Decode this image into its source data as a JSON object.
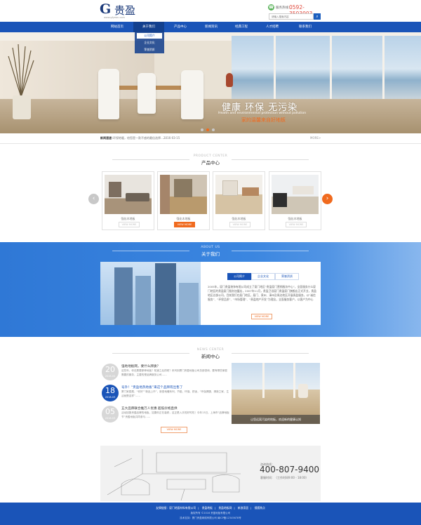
{
  "header": {
    "logo": {
      "latin": "G",
      "cn": "贵盈",
      "url": "www.gfyeon.com"
    },
    "hotline": {
      "label": "服务热线：",
      "number": "0592-3503003"
    },
    "search": {
      "placeholder": "请输入搜索内容",
      "icon": "search-icon"
    }
  },
  "nav": {
    "items": [
      {
        "label": "网站首页"
      },
      {
        "label": "关于我们",
        "active": true
      },
      {
        "label": "产品中心"
      },
      {
        "label": "新闻资讯"
      },
      {
        "label": "经典工程"
      },
      {
        "label": "人才招聘"
      },
      {
        "label": "联系我们"
      }
    ],
    "dropdown": [
      "公司简介",
      "企业文化",
      "荣誉资质"
    ]
  },
  "banner": {
    "slogan_cn": "健康 环保 无污染",
    "slogan_en": "Health and environmental protection without pollution",
    "slogan_sub": "家的温馨来自好地板",
    "dots": 3,
    "active_dot": 1
  },
  "ticker": {
    "label": "新闻速递：",
    "text": "环保地暖，给您是一款不惑的最佳选择……",
    "date": "2016-03-15",
    "more": "MORE>"
  },
  "products": {
    "title_en": "PRODUCT CENTER",
    "title_cn": "产品中心",
    "view_more": "VIEW MORE",
    "items": [
      {
        "caption": "强化木地板"
      },
      {
        "caption": "强化木地板",
        "active": true
      },
      {
        "caption": "强化木地板"
      },
      {
        "caption": "强化木地板"
      }
    ]
  },
  "about": {
    "title_en": "ABOUT US",
    "title_cn": "关于我们",
    "tabs": [
      {
        "label": "公司简介",
        "active": true
      },
      {
        "label": "企业文化"
      },
      {
        "label": "荣誉资质"
      }
    ],
    "text": "2005年，厦门贵盈装饰有限公司成立了厦门地区“贵盈厦门营销服务中心”，全面服务什么厦门地区的贵盈厦门服务加盟店，2007年11月，贵盈卫浴厦门贵盈厦门旗舰店正式开业，贵盈地区总部公司，目前我们在厦门地区，厦门、泉州、漳州及周边地区开展贵盈服务，以“诚信服务”、“环保品质”、“市场管理”、“贵盈地产开发”为理念，全面服务客户，以客户为中心",
    "view_more": "VIEW MORE"
  },
  "news": {
    "title_en": "NEWS CENTER",
    "title_cn": "新闻中心",
    "items": [
      {
        "day": "20",
        "ym": "2016-04",
        "title": "强地地板网，要什么牌质？",
        "desc": "这些年，你还是要那种地板？知道之后的呢？系列到厦门贵盈地板公司总部咨询，要有哪些家庭需要的服务，主要的是品牌服务公司……"
      },
      {
        "day": "18",
        "ym": "2016-03",
        "title": "号外！“贵盈地热地板”来这个品牌有出售了",
        "desc": "厦门家居展，“你好”“新品上市”，新型地暖系列，节能、环保、舒适，“环保健康，清新之家，生活就是这样”……",
        "active": true
      },
      {
        "day": "05",
        "ym": "2016-03",
        "title": "五大品牌联合推万人优惠 超低价格直供",
        "desc": "活动回报贵盈品牌的地板，如果你正在装修，这正是入手的好时机！今年13日，上海市“品牌地板节”贵盈地板共同参与……"
      }
    ],
    "feature_caption": "让您远离污染的地板，欢迎新的健康认知",
    "view_more": "VIEW MORE"
  },
  "contact": {
    "label": "咨询热线：",
    "tel": "400-807-9400",
    "hours": "客服时间：（工作时间9:00 - 18:00）"
  },
  "footer": {
    "links": [
      "友情链接：厦门地面材料有限公司",
      "贵盈地板",
      "贵盈地板网",
      "新浪家居",
      "搜狐焦点"
    ],
    "line2": "版权所有 ©2016 贵盈地板有限公司",
    "line3": "技术支持：厦门贵盈网络有限公司  闽ICP备12345678号"
  }
}
